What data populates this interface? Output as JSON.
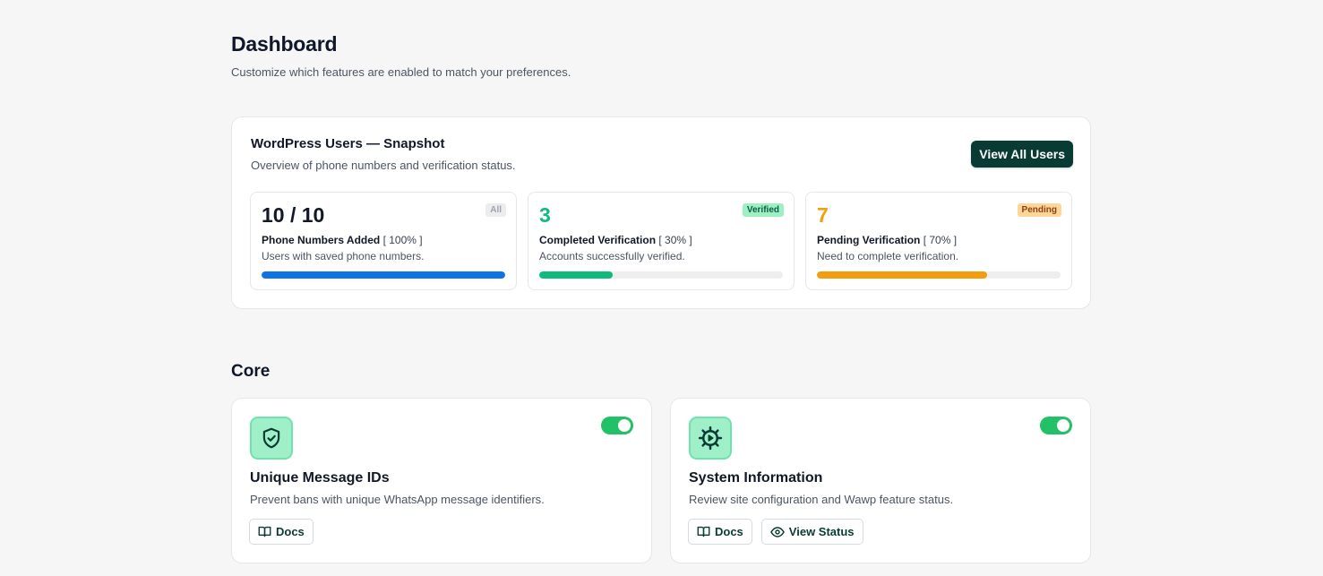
{
  "header": {
    "title": "Dashboard",
    "subtitle": "Customize which features are enabled to match your preferences."
  },
  "snapshot": {
    "title": "WordPress Users — Snapshot",
    "subtitle": "Overview of phone numbers and verification status.",
    "button_label": "View All Users",
    "stats": [
      {
        "value": "10 / 10",
        "badge": "All",
        "label": "Phone Numbers Added",
        "percent_text": "[ 100% ]",
        "description": "Users with saved phone numbers.",
        "progress": 100,
        "color": "#0f73e6",
        "value_color": "#111827",
        "badge_bg": "#ededed",
        "badge_color": "#9ca3af"
      },
      {
        "value": "3",
        "badge": "Verified",
        "label": "Completed Verification",
        "percent_text": "[ 30% ]",
        "description": "Accounts successfully verified.",
        "progress": 30,
        "color": "#0fba7c",
        "value_color": "#10b981",
        "badge_bg": "#9ef0c2",
        "badge_color": "#065f46"
      },
      {
        "value": "7",
        "badge": "Pending",
        "label": "Pending Verification",
        "percent_text": "[ 70% ]",
        "description": "Need to complete verification.",
        "progress": 70,
        "color": "#f39c0f",
        "value_color": "#f59e0b",
        "badge_bg": "#fdd69a",
        "badge_color": "#92400e"
      }
    ]
  },
  "core": {
    "title": "Core",
    "features": [
      {
        "icon": "shield-check-icon",
        "title": "Unique Message IDs",
        "description": "Prevent bans with unique WhatsApp message identifiers.",
        "enabled": true,
        "docs_label": "Docs"
      },
      {
        "icon": "gear-icon",
        "title": "System Information",
        "description": "Review site configuration and Wawp feature status.",
        "enabled": true,
        "docs_label": "Docs",
        "status_label": "View Status"
      }
    ]
  },
  "colors": {
    "accent_dark": "#073b33",
    "toggle_on": "#22c067",
    "icon_bg": "#9ff0c8"
  }
}
